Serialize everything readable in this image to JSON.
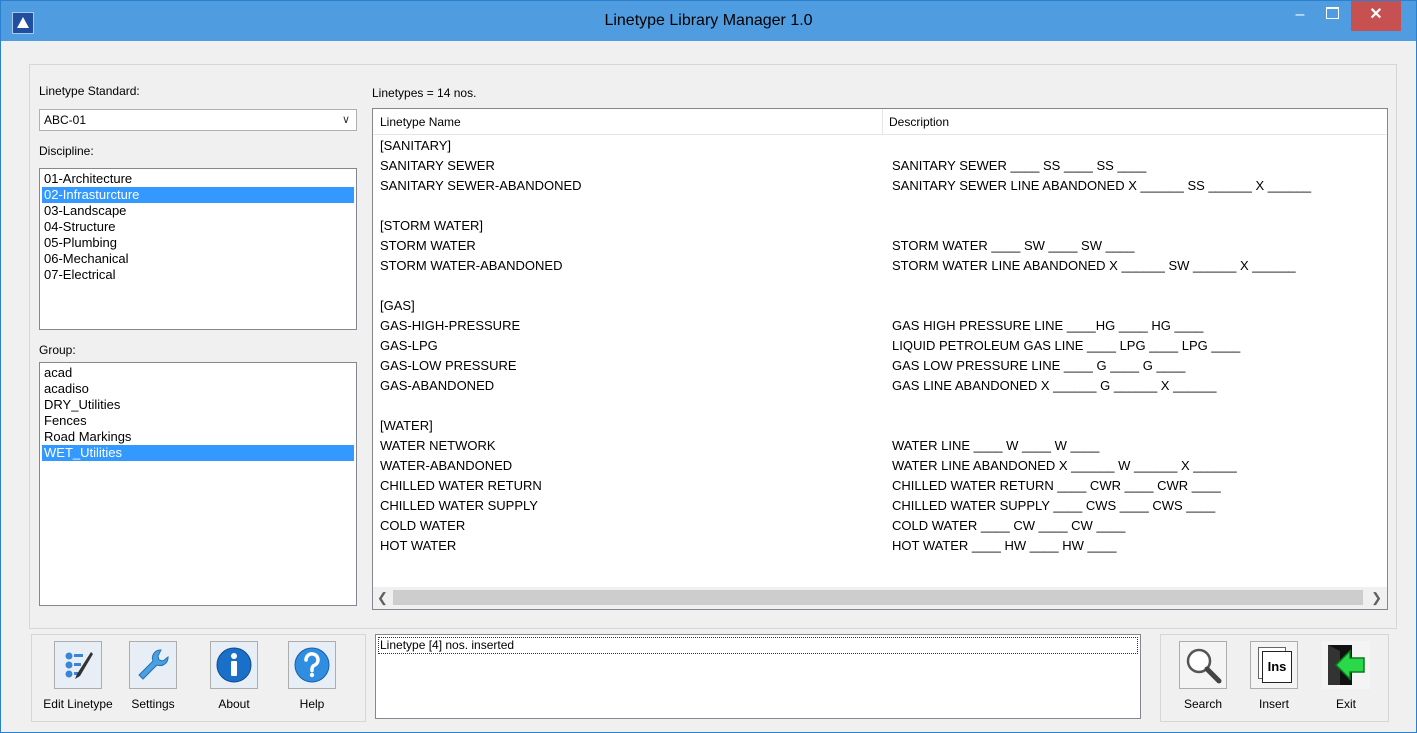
{
  "window": {
    "title": "Linetype Library Manager 1.0",
    "minimize": "–",
    "close": "✕"
  },
  "linetype_standard": {
    "label": "Linetype Standard:",
    "selected": "ABC-01"
  },
  "discipline": {
    "label": "Discipline:",
    "items": [
      "01-Architecture",
      "02-Infrasturcture",
      "03-Landscape",
      "04-Structure",
      "05-Plumbing",
      "06-Mechanical",
      "07-Electrical"
    ],
    "selected_index": 1
  },
  "group": {
    "label": "Group:",
    "items": [
      "acad",
      "acadiso",
      "DRY_Utilities",
      "Fences",
      "Road Markings",
      "WET_Utilities"
    ],
    "selected_index": 5
  },
  "linetypes": {
    "count_label": "Linetypes = 14 nos.",
    "columns": [
      "Linetype Name",
      "Description"
    ],
    "rows": [
      [
        "[SANITARY]",
        ""
      ],
      [
        "SANITARY SEWER",
        "SANITARY SEWER ____ SS ____ SS ____"
      ],
      [
        "SANITARY SEWER-ABANDONED",
        "SANITARY SEWER LINE ABANDONED X ______ SS ______ X ______"
      ],
      [
        "",
        ""
      ],
      [
        "[STORM WATER]",
        ""
      ],
      [
        "STORM WATER",
        "STORM WATER ____ SW ____ SW ____"
      ],
      [
        "STORM WATER-ABANDONED",
        "STORM WATER LINE ABANDONED X ______ SW ______ X ______"
      ],
      [
        "",
        ""
      ],
      [
        "[GAS]",
        ""
      ],
      [
        "GAS-HIGH-PRESSURE",
        "GAS HIGH PRESSURE LINE ____HG ____ HG ____"
      ],
      [
        "GAS-LPG",
        "LIQUID PETROLEUM GAS LINE ____ LPG ____ LPG ____"
      ],
      [
        "GAS-LOW PRESSURE",
        "GAS LOW PRESSURE LINE ____ G ____ G ____"
      ],
      [
        "GAS-ABANDONED",
        "GAS LINE ABANDONED X ______ G ______ X ______"
      ],
      [
        "",
        ""
      ],
      [
        "[WATER]",
        ""
      ],
      [
        "WATER NETWORK",
        "WATER LINE ____ W ____ W ____"
      ],
      [
        "WATER-ABANDONED",
        "WATER LINE ABANDONED X ______ W ______ X ______"
      ],
      [
        "CHILLED WATER RETURN",
        "CHILLED WATER RETURN ____ CWR ____ CWR ____"
      ],
      [
        "CHILLED WATER SUPPLY",
        "CHILLED WATER SUPPLY ____ CWS ____ CWS ____"
      ],
      [
        "COLD WATER",
        "COLD WATER ____ CW ____ CW ____"
      ],
      [
        "HOT WATER",
        "HOT WATER ____ HW ____ HW ____"
      ]
    ]
  },
  "left_toolbar": {
    "edit_linetype": "Edit Linetype",
    "settings": "Settings",
    "about": "About",
    "help": "Help"
  },
  "status": {
    "message": "Linetype [4] nos. inserted"
  },
  "right_toolbar": {
    "search": "Search",
    "insert": "Insert",
    "exit": "Exit",
    "insert_icon_text": "Ins"
  },
  "colors": {
    "titlebar": "#4f9de0",
    "selection": "#3399ff",
    "close_button": "#c75050"
  }
}
